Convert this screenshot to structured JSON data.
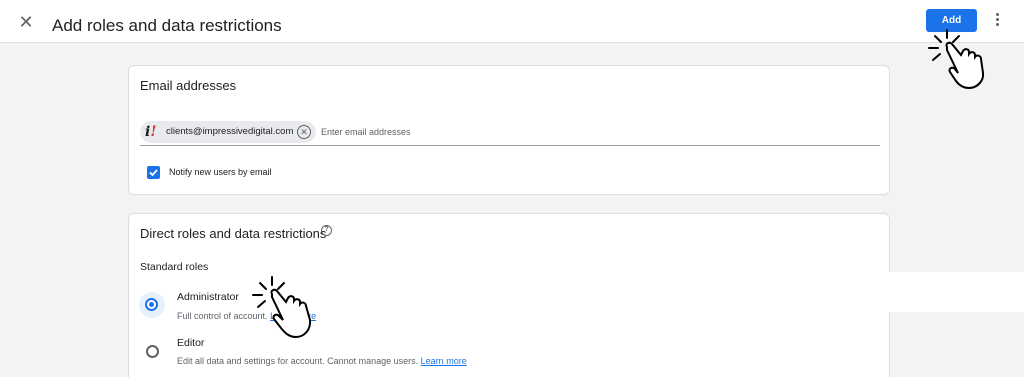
{
  "header": {
    "close_icon": "close-icon",
    "title": "Add roles and data restrictions",
    "add_label": "Add",
    "more_icon": "more-vert-icon",
    "accent": "#1a73e8"
  },
  "email_card": {
    "title": "Email addresses",
    "chip": {
      "logo_icon": "impressive-digital-logo",
      "email": "clients@impressivedigital.com",
      "remove_icon": "cancel-circle-icon"
    },
    "input_placeholder": "Enter email addresses",
    "notify": {
      "checked": true,
      "label": "Notify new users by email"
    }
  },
  "roles_card": {
    "title": "Direct roles and data restrictions",
    "help_icon": "help-circle-icon",
    "subhead": "Standard roles",
    "roles": [
      {
        "name": "Administrator",
        "description": "Full control of account.",
        "link": "Learn more",
        "selected": true
      },
      {
        "name": "Editor",
        "description": "Edit all data and settings for account. Cannot manage users.",
        "link": "Learn more",
        "selected": false
      }
    ]
  },
  "annotations": {
    "pointer_icon": "pointing-hand-icon"
  }
}
